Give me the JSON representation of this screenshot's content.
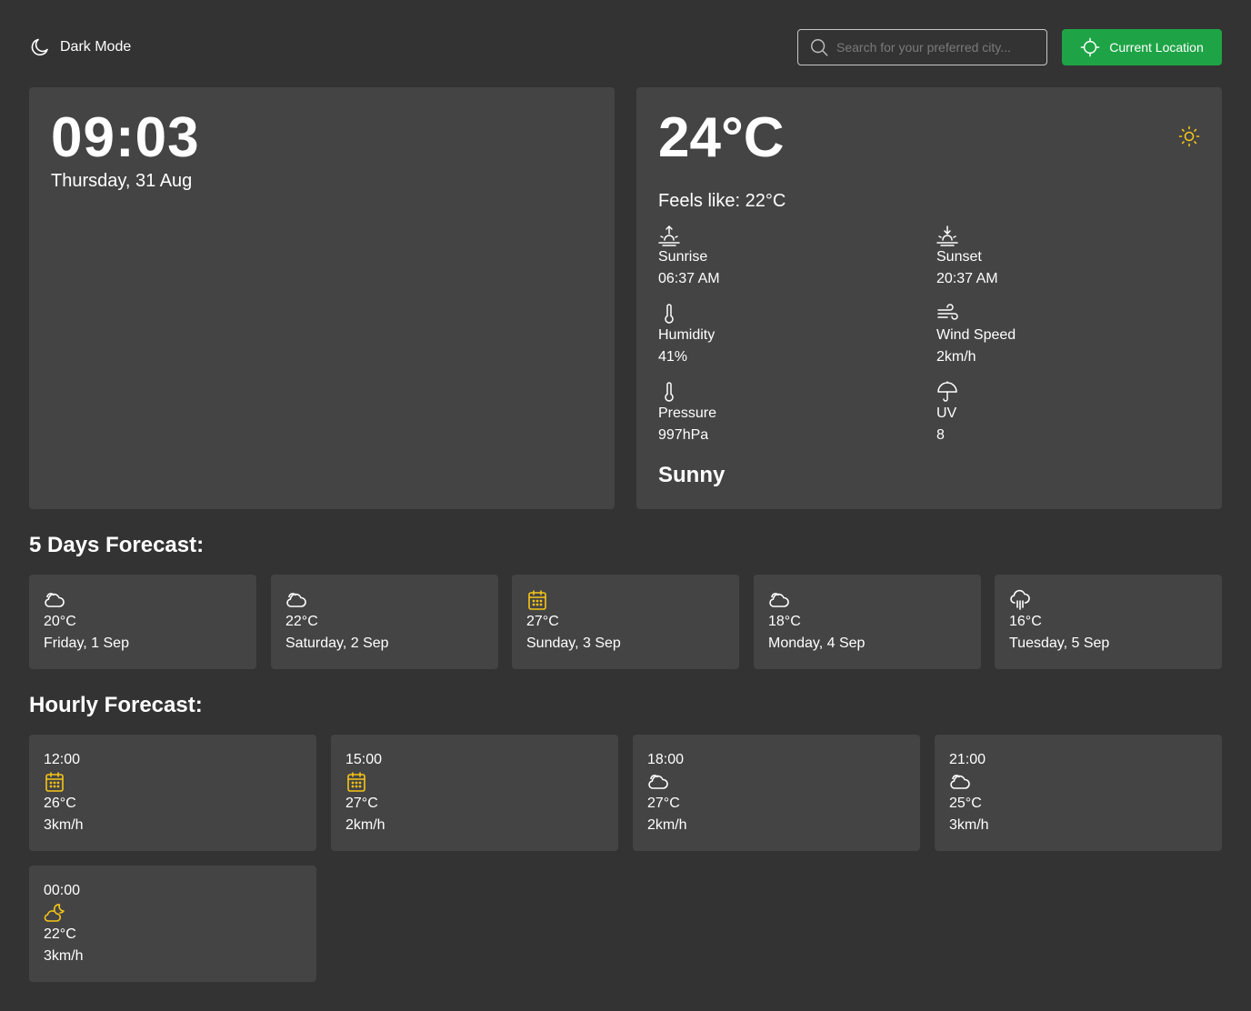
{
  "theme_toggle": {
    "label": "Dark Mode"
  },
  "search": {
    "placeholder": "Search for your preferred city..."
  },
  "location_button": {
    "label": "Current Location"
  },
  "clock": {
    "time": "09:03",
    "date": "Thursday, 31 Aug"
  },
  "current": {
    "temperature": "24°C",
    "feels_like": "Feels like: 22°C",
    "condition": "Sunny",
    "details": [
      {
        "label": "Sunrise",
        "value": "06:37 AM",
        "icon": "sunrise-icon"
      },
      {
        "label": "Sunset",
        "value": "20:37 AM",
        "icon": "sunset-icon"
      },
      {
        "label": "Humidity",
        "value": "41%",
        "icon": "thermometer-icon"
      },
      {
        "label": "Wind Speed",
        "value": "2km/h",
        "icon": "wind-icon"
      },
      {
        "label": "Pressure",
        "value": "997hPa",
        "icon": "thermometer-icon"
      },
      {
        "label": "UV",
        "value": "8",
        "icon": "umbrella-icon"
      }
    ]
  },
  "forecast": {
    "title": "5 Days Forecast:",
    "days": [
      {
        "temp": "20°C",
        "date": "Friday, 1 Sep",
        "icon": "cloud-icon"
      },
      {
        "temp": "22°C",
        "date": "Saturday, 2 Sep",
        "icon": "cloud-icon"
      },
      {
        "temp": "27°C",
        "date": "Sunday, 3 Sep",
        "icon": "calendar-icon"
      },
      {
        "temp": "18°C",
        "date": "Monday, 4 Sep",
        "icon": "cloud-icon"
      },
      {
        "temp": "16°C",
        "date": "Tuesday, 5 Sep",
        "icon": "cloud-rain-icon"
      }
    ]
  },
  "hourly": {
    "title": "Hourly Forecast:",
    "hours": [
      {
        "time": "12:00",
        "temp": "26°C",
        "wind": "3km/h",
        "icon": "calendar-icon"
      },
      {
        "time": "15:00",
        "temp": "27°C",
        "wind": "2km/h",
        "icon": "calendar-icon"
      },
      {
        "time": "18:00",
        "temp": "27°C",
        "wind": "2km/h",
        "icon": "cloud-icon"
      },
      {
        "time": "21:00",
        "temp": "25°C",
        "wind": "3km/h",
        "icon": "cloud-icon"
      },
      {
        "time": "00:00",
        "temp": "22°C",
        "wind": "3km/h",
        "icon": "cloud-moon-icon"
      }
    ]
  },
  "colors": {
    "background": "#333333",
    "card": "#444444",
    "accent_green": "#1ea446",
    "icon_yellow": "#f5c518"
  }
}
